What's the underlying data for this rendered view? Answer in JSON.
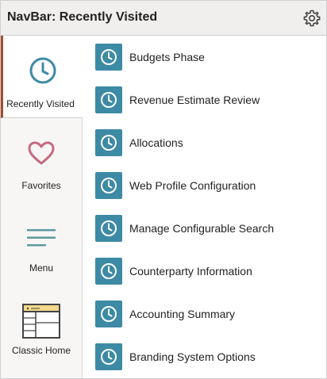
{
  "header": {
    "title": "NavBar: Recently Visited",
    "settings_icon": "gear-icon"
  },
  "sidebar": {
    "items": [
      {
        "label": "Recently Visited",
        "icon": "clock-icon",
        "active": true
      },
      {
        "label": "Favorites",
        "icon": "heart-icon",
        "active": false
      },
      {
        "label": "Menu",
        "icon": "menu-lines-icon",
        "active": false
      },
      {
        "label": "Classic Home",
        "icon": "classic-home-window-icon",
        "active": false
      }
    ]
  },
  "recent_list": {
    "item_icon": "clock-icon",
    "items": [
      {
        "label": "Budgets Phase"
      },
      {
        "label": "Revenue Estimate Review"
      },
      {
        "label": "Allocations"
      },
      {
        "label": "Web Profile Configuration"
      },
      {
        "label": "Manage Configurable Search"
      },
      {
        "label": "Counterparty Information"
      },
      {
        "label": "Accounting Summary"
      },
      {
        "label": "Branding System Options"
      }
    ]
  },
  "colors": {
    "accent_teal": "#3d8aa5",
    "active_marker": "#a24e2c",
    "heart": "#c56a7f",
    "menu_lines": "#5b9aa0",
    "header_bg": "#f0efed",
    "sidebar_bg": "#f7f6f5"
  }
}
